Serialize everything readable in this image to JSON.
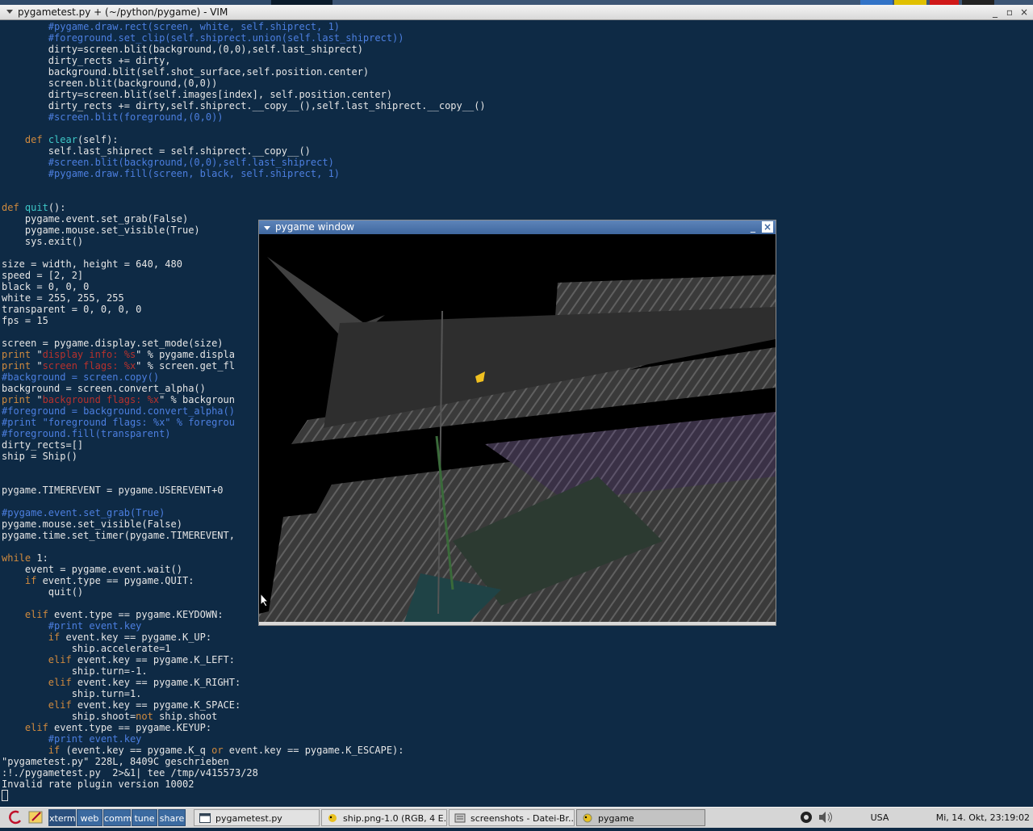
{
  "window": {
    "title": "pygametest.py + (~/python/pygame) - VIM",
    "minimize": "_",
    "maximize": "▫",
    "close": "×"
  },
  "colors": {
    "background": "#0e2a45",
    "normal": "#e6e6e6",
    "keyword": "#d08a3e",
    "function": "#3ec8c8",
    "comment": "#4c7fe0",
    "string": "#b8312c"
  },
  "code_lines": [
    [
      {
        "t": "        "
      },
      {
        "c": "cm",
        "t": "#pygame.draw.rect(screen, white, self.shiprect, 1)"
      }
    ],
    [
      {
        "t": "        "
      },
      {
        "c": "cm",
        "t": "#foreground.set_clip(self.shiprect.union(self.last_shiprect))"
      }
    ],
    [
      {
        "t": "        dirty=screen.blit(background,(0,0),self.last_shiprect)"
      }
    ],
    [
      {
        "t": "        dirty_rects += dirty,"
      }
    ],
    [
      {
        "t": "        background.blit(self.shot_surface,self.position.center)"
      }
    ],
    [
      {
        "t": "        screen.blit(background,(0,0))"
      }
    ],
    [
      {
        "t": "        dirty=screen.blit(self.images[index], self.position.center)"
      }
    ],
    [
      {
        "t": "        dirty_rects += dirty,self.shiprect.__copy__(),self.last_shiprect.__copy__()"
      }
    ],
    [
      {
        "t": "        "
      },
      {
        "c": "cm",
        "t": "#screen.blit(foreground,(0,0))"
      }
    ],
    [
      {
        "t": ""
      }
    ],
    [
      {
        "t": "    "
      },
      {
        "c": "kw",
        "t": "def"
      },
      {
        "t": " "
      },
      {
        "c": "fn",
        "t": "clear"
      },
      {
        "t": "(self):"
      }
    ],
    [
      {
        "t": "        self.last_shiprect = self.shiprect.__copy__()"
      }
    ],
    [
      {
        "t": "        "
      },
      {
        "c": "cm",
        "t": "#screen.blit(background,(0,0),self.last_shiprect)"
      }
    ],
    [
      {
        "t": "        "
      },
      {
        "c": "cm",
        "t": "#pygame.draw.fill(screen, black, self.shiprect, 1)"
      }
    ],
    [
      {
        "t": ""
      }
    ],
    [
      {
        "t": ""
      }
    ],
    [
      {
        "c": "kw",
        "t": "def"
      },
      {
        "t": " "
      },
      {
        "c": "fn",
        "t": "quit"
      },
      {
        "t": "():"
      }
    ],
    [
      {
        "t": "    pygame.event.set_grab(False)"
      }
    ],
    [
      {
        "t": "    pygame.mouse.set_visible(True)"
      }
    ],
    [
      {
        "t": "    sys.exit()"
      }
    ],
    [
      {
        "t": ""
      }
    ],
    [
      {
        "t": "size = width, height = 640, 480"
      }
    ],
    [
      {
        "t": "speed = [2, 2]"
      }
    ],
    [
      {
        "t": "black = 0, 0, 0"
      }
    ],
    [
      {
        "t": "white = 255, 255, 255"
      }
    ],
    [
      {
        "t": "transparent = 0, 0, 0, 0"
      }
    ],
    [
      {
        "t": "fps = 15"
      }
    ],
    [
      {
        "t": ""
      }
    ],
    [
      {
        "t": "screen = pygame.display.set_mode(size)"
      }
    ],
    [
      {
        "c": "kw",
        "t": "print"
      },
      {
        "t": " \""
      },
      {
        "c": "st",
        "t": "display info: %s"
      },
      {
        "t": "\" % pygame.displa"
      }
    ],
    [
      {
        "c": "kw",
        "t": "print"
      },
      {
        "t": " \""
      },
      {
        "c": "st",
        "t": "screen flags: %x"
      },
      {
        "t": "\" % screen.get_fl"
      }
    ],
    [
      {
        "c": "cm",
        "t": "#background = screen.copy()"
      }
    ],
    [
      {
        "t": "background = screen.convert_alpha()"
      }
    ],
    [
      {
        "c": "kw",
        "t": "print"
      },
      {
        "t": " \""
      },
      {
        "c": "st",
        "t": "background flags: %x"
      },
      {
        "t": "\" % backgroun"
      }
    ],
    [
      {
        "c": "cm",
        "t": "#foreground = background.convert_alpha()"
      }
    ],
    [
      {
        "c": "cm",
        "t": "#print \"foreground flags: %x\" % foregrou"
      }
    ],
    [
      {
        "c": "cm",
        "t": "#foreground.fill(transparent)"
      }
    ],
    [
      {
        "t": "dirty_rects=[]"
      }
    ],
    [
      {
        "t": "ship = Ship()"
      }
    ],
    [
      {
        "t": ""
      }
    ],
    [
      {
        "t": ""
      }
    ],
    [
      {
        "t": "pygame.TIMEREVENT = pygame.USEREVENT+0"
      }
    ],
    [
      {
        "t": ""
      }
    ],
    [
      {
        "c": "cm",
        "t": "#pygame.event.set_grab(True)"
      }
    ],
    [
      {
        "t": "pygame.mouse.set_visible(False)"
      }
    ],
    [
      {
        "t": "pygame.time.set_timer(pygame.TIMEREVENT,"
      }
    ],
    [
      {
        "t": ""
      }
    ],
    [
      {
        "c": "kw",
        "t": "while"
      },
      {
        "t": " 1:"
      }
    ],
    [
      {
        "t": "    event = pygame.event.wait()"
      }
    ],
    [
      {
        "t": "    "
      },
      {
        "c": "kw",
        "t": "if"
      },
      {
        "t": " event.type == pygame.QUIT:"
      }
    ],
    [
      {
        "t": "        quit()"
      }
    ],
    [
      {
        "t": ""
      }
    ],
    [
      {
        "t": "    "
      },
      {
        "c": "kw",
        "t": "elif"
      },
      {
        "t": " event.type == pygame.KEYDOWN:"
      }
    ],
    [
      {
        "t": "        "
      },
      {
        "c": "cm",
        "t": "#print event.key"
      }
    ],
    [
      {
        "t": "        "
      },
      {
        "c": "kw",
        "t": "if"
      },
      {
        "t": " event.key == pygame.K_UP:"
      }
    ],
    [
      {
        "t": "            ship.accelerate=1"
      }
    ],
    [
      {
        "t": "        "
      },
      {
        "c": "kw",
        "t": "elif"
      },
      {
        "t": " event.key == pygame.K_LEFT:"
      }
    ],
    [
      {
        "t": "            ship.turn=-1."
      }
    ],
    [
      {
        "t": "        "
      },
      {
        "c": "kw",
        "t": "elif"
      },
      {
        "t": " event.key == pygame.K_RIGHT:"
      }
    ],
    [
      {
        "t": "            ship.turn=1."
      }
    ],
    [
      {
        "t": "        "
      },
      {
        "c": "kw",
        "t": "elif"
      },
      {
        "t": " event.key == pygame.K_SPACE:"
      }
    ],
    [
      {
        "t": "            ship.shoot="
      },
      {
        "c": "kw",
        "t": "not"
      },
      {
        "t": " ship.shoot"
      }
    ],
    [
      {
        "t": "    "
      },
      {
        "c": "kw",
        "t": "elif"
      },
      {
        "t": " event.type == pygame.KEYUP:"
      }
    ],
    [
      {
        "t": "        "
      },
      {
        "c": "cm",
        "t": "#print event.key"
      }
    ],
    [
      {
        "t": "        "
      },
      {
        "c": "kw",
        "t": "if"
      },
      {
        "t": " (event.key == pygame.K_q "
      },
      {
        "c": "kw",
        "t": "or"
      },
      {
        "t": " event.key == pygame.K_ESCAPE):"
      }
    ],
    [
      {
        "t": "\"pygametest.py\" 228L, 8409C geschrieben"
      }
    ],
    [
      {
        "t": ":!./pygametest.py  2>&1| tee /tmp/v415573/28"
      }
    ],
    [
      {
        "t": "Invalid rate plugin version 10002"
      }
    ]
  ],
  "pygame_window": {
    "title": "pygame window",
    "minimize": "_",
    "close": "×"
  },
  "taskbar": {
    "quicklaunch": [
      "xterm",
      "web",
      "comm",
      "tune",
      "share"
    ],
    "tasks": [
      {
        "label": "pygametest.py",
        "icon": "text-editor-icon"
      },
      {
        "label": "ship.png-1.0 (RGB, 4 E...",
        "icon": "gimp-icon"
      },
      {
        "label": "screenshots - Datei-Br...",
        "icon": "file-browser-icon"
      },
      {
        "label": "pygame",
        "icon": "python-icon"
      }
    ],
    "tray_icons": [
      "network-icon",
      "volume-icon"
    ],
    "keyboard_layout": "USA",
    "clock": "Mi, 14. Okt, 23:19:02"
  }
}
